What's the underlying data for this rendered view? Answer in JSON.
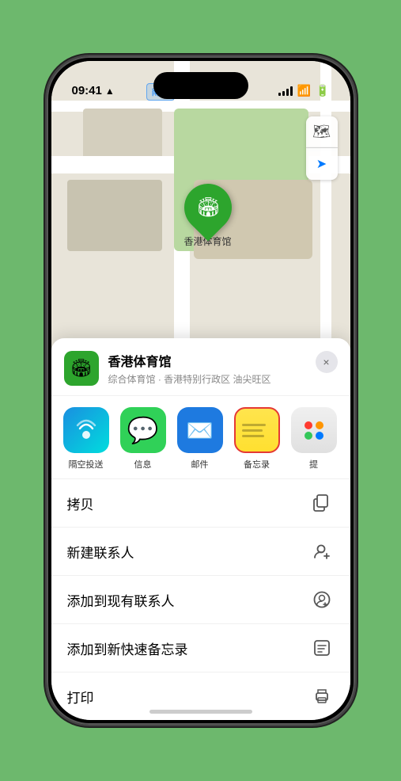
{
  "statusBar": {
    "time": "09:41",
    "locationIcon": "▲"
  },
  "map": {
    "northEntryLabel": "南口",
    "venueLabel": "香港体育馆"
  },
  "mapControls": {
    "mapTypeIcon": "🗺",
    "locationIcon": "➤"
  },
  "venueCard": {
    "name": "香港体育馆",
    "subtitle": "综合体育馆 · 香港特别行政区 油尖旺区",
    "closeLabel": "×"
  },
  "shareItems": [
    {
      "id": "airdrop",
      "label": "隔空投送",
      "type": "airdrop"
    },
    {
      "id": "messages",
      "label": "信息",
      "type": "messages"
    },
    {
      "id": "mail",
      "label": "邮件",
      "type": "mail"
    },
    {
      "id": "notes",
      "label": "备忘录",
      "type": "notes"
    },
    {
      "id": "more",
      "label": "提",
      "type": "more"
    }
  ],
  "actionItems": [
    {
      "id": "copy",
      "label": "拷贝",
      "iconType": "copy"
    },
    {
      "id": "new-contact",
      "label": "新建联系人",
      "iconType": "person-add"
    },
    {
      "id": "add-existing",
      "label": "添加到现有联系人",
      "iconType": "person-circle"
    },
    {
      "id": "quick-note",
      "label": "添加到新快速备忘录",
      "iconType": "note"
    },
    {
      "id": "print",
      "label": "打印",
      "iconType": "print"
    }
  ]
}
